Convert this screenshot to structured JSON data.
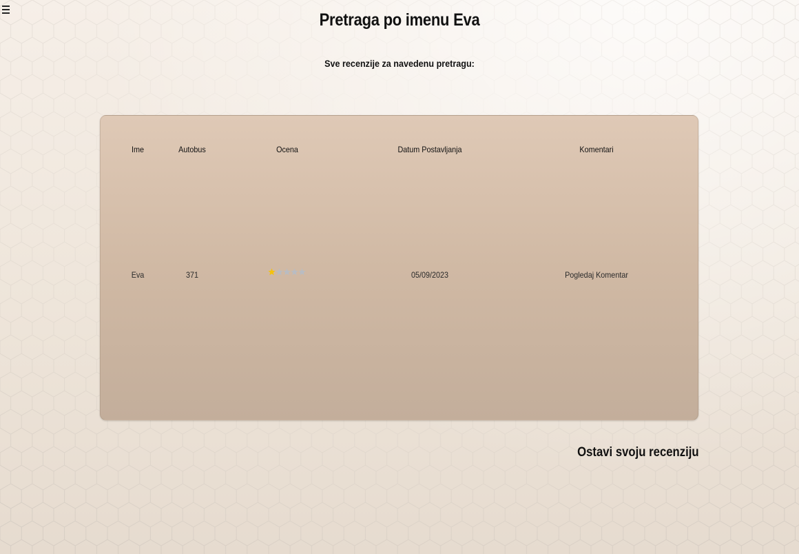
{
  "header": {
    "title": "Pretraga po imenu Eva",
    "subtitle": "Sve recenzije za navedenu pretragu:",
    "menu_icon": "hamburger-menu-icon"
  },
  "table": {
    "columns": [
      "Ime",
      "Autobus",
      "Ocena",
      "Datum Postavljanja",
      "Komentari"
    ],
    "rows": [
      {
        "ime": "Eva",
        "autobus": "371",
        "ocena": 1,
        "ocena_max": 5,
        "datum": "05/09/2023",
        "komentar_link": "Pogledaj Komentar"
      }
    ]
  },
  "footer": {
    "leave_review_label": "Ostavi svoju recenziju"
  },
  "colors": {
    "star_filled": "#f4c20d",
    "star_empty": "#b9bcc2",
    "card_top": "#dfc9b6",
    "card_bottom": "#c3ae9b"
  }
}
